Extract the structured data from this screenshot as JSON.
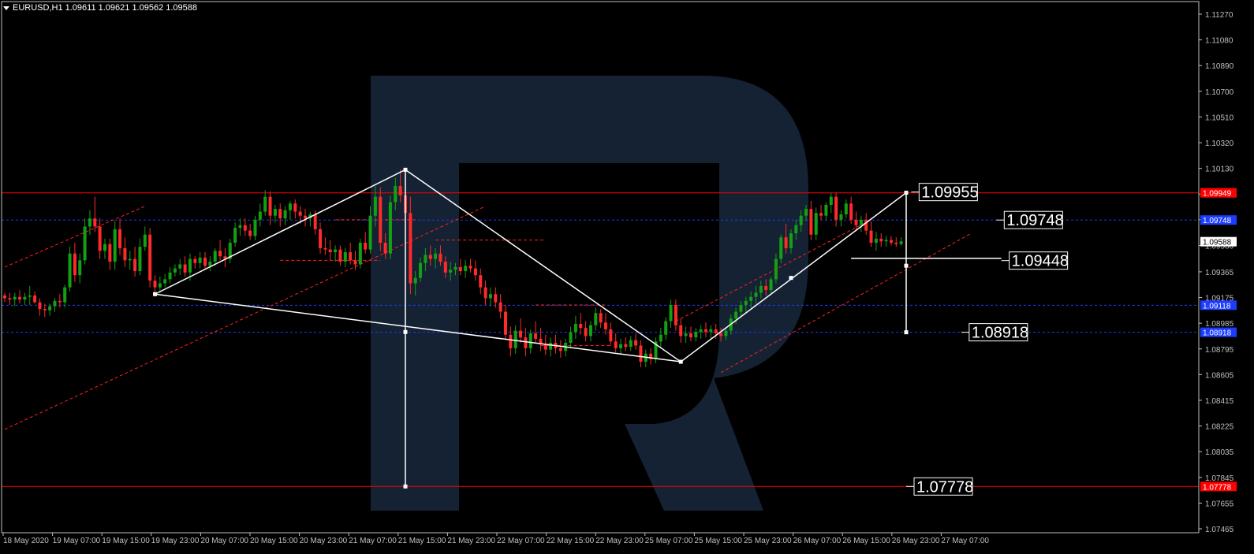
{
  "header": {
    "symbol_line": "EURUSD,H1  1.09611 1.09621 1.09562 1.09588"
  },
  "colors": {
    "background": "#000000",
    "axis": "#c0c0c0",
    "bull": "#13a113",
    "bear": "#ff2a2a",
    "level_red": "#ff0000",
    "level_blue": "#1c3cff",
    "pattern": "#ffffff",
    "channel": "#ff2020",
    "watermark": "#142233"
  },
  "chart_data": {
    "type": "candlestick",
    "symbol": "EURUSD",
    "timeframe": "H1",
    "ohlc_last": {
      "open": 1.09611,
      "high": 1.09621,
      "low": 1.09562,
      "close": 1.09588
    },
    "ylim": [
      1.07465,
      1.1127
    ],
    "y_ticks": [
      "1.11270",
      "1.11080",
      "1.10890",
      "1.10700",
      "1.10510",
      "1.10320",
      "1.10130",
      "1.09940",
      "1.09750",
      "1.09560",
      "1.09365",
      "1.09175",
      "1.08985",
      "1.08795",
      "1.08605",
      "1.08415",
      "1.08225",
      "1.08035",
      "1.07845",
      "1.07655",
      "1.07465"
    ],
    "x_labels": [
      "18 May 2020",
      "19 May 07:00",
      "19 May 15:00",
      "19 May 23:00",
      "20 May 07:00",
      "20 May 15:00",
      "20 May 23:00",
      "21 May 07:00",
      "21 May 15:00",
      "21 May 23:00",
      "22 May 07:00",
      "22 May 15:00",
      "22 May 23:00",
      "25 May 07:00",
      "25 May 15:00",
      "25 May 23:00",
      "26 May 07:00",
      "26 May 15:00",
      "26 May 23:00",
      "27 May 07:00"
    ],
    "axis_markers": [
      {
        "label": "1.09949",
        "value": 1.09949,
        "color": "red"
      },
      {
        "label": "1.09748",
        "value": 1.09748,
        "color": "blue"
      },
      {
        "label": "1.09588",
        "value": 1.09588,
        "color": "current"
      },
      {
        "label": "1.09118",
        "value": 1.09118,
        "color": "blue"
      },
      {
        "label": "1.08918",
        "value": 1.08918,
        "color": "blue"
      },
      {
        "label": "1.07778",
        "value": 1.07778,
        "color": "red"
      }
    ],
    "horizontal_levels": [
      {
        "value": 1.09949,
        "style": "solid",
        "color": "red"
      },
      {
        "value": 1.09748,
        "style": "dashed",
        "color": "blue"
      },
      {
        "value": 1.09118,
        "style": "dashed",
        "color": "blue"
      },
      {
        "value": 1.08918,
        "style": "dashed",
        "color": "blue"
      },
      {
        "value": 1.07778,
        "style": "solid",
        "color": "red"
      }
    ],
    "annotations": [
      {
        "label": "1.09955",
        "bar": 181,
        "value": 1.09955
      },
      {
        "label": "1.09748",
        "bar": 198,
        "value": 1.09748
      },
      {
        "label": "1.09448",
        "bar": 199,
        "value": 1.09448
      },
      {
        "label": "1.08918",
        "bar": 191,
        "value": 1.08918
      },
      {
        "label": "1.07778",
        "bar": 180,
        "value": 1.07778
      }
    ],
    "pattern_lines": [
      {
        "from": [
          30,
          1.092
        ],
        "to": [
          80,
          1.1012
        ]
      },
      {
        "from": [
          80,
          1.1012
        ],
        "to": [
          135,
          1.087
        ]
      },
      {
        "from": [
          30,
          1.092
        ],
        "to": [
          135,
          1.087
        ]
      },
      {
        "from": [
          135,
          1.087
        ],
        "to": [
          180,
          1.0995
        ]
      },
      {
        "from": [
          80,
          1.1012
        ],
        "to": [
          80,
          1.07778
        ]
      },
      {
        "from": [
          180,
          1.0995
        ],
        "to": [
          180,
          1.08918
        ]
      },
      {
        "from": [
          169,
          1.09465
        ],
        "to": [
          199,
          1.09465
        ]
      }
    ],
    "pattern_points": [
      [
        30,
        1.092
      ],
      [
        80,
        1.1012
      ],
      [
        80,
        1.0892
      ],
      [
        80,
        1.07778
      ],
      [
        135,
        1.087
      ],
      [
        157,
        1.0932
      ],
      [
        180,
        1.0995
      ],
      [
        180,
        1.0941
      ],
      [
        180,
        1.08918
      ]
    ],
    "channel_lines": [
      [
        [
          0,
          1.094
        ],
        [
          28,
          1.0985
        ]
      ],
      [
        [
          0,
          1.082
        ],
        [
          96,
          1.0985
        ]
      ],
      [
        [
          55,
          1.0945
        ],
        [
          75,
          1.0945
        ]
      ],
      [
        [
          66,
          1.0975
        ],
        [
          82,
          1.0975
        ]
      ],
      [
        [
          86,
          1.096
        ],
        [
          108,
          1.096
        ]
      ],
      [
        [
          106,
          1.0912
        ],
        [
          120,
          1.0912
        ]
      ],
      [
        [
          107,
          1.0882
        ],
        [
          121,
          1.0882
        ]
      ],
      [
        [
          134,
          1.09
        ],
        [
          173,
          1.0975
        ]
      ],
      [
        [
          143,
          1.0862
        ],
        [
          193,
          1.0965
        ]
      ]
    ],
    "bars": 192,
    "candles": [
      [
        1.0919,
        1.0921,
        1.0914,
        1.0917
      ],
      [
        1.0917,
        1.0921,
        1.0912,
        1.0916
      ],
      [
        1.0916,
        1.0921,
        1.0911,
        1.0918
      ],
      [
        1.0918,
        1.0923,
        1.0913,
        1.0916
      ],
      [
        1.0916,
        1.0921,
        1.0912,
        1.0918
      ],
      [
        1.0918,
        1.0926,
        1.0912,
        1.0919
      ],
      [
        1.0919,
        1.0922,
        1.0913,
        1.0914
      ],
      [
        1.0914,
        1.0917,
        1.0904,
        1.0909
      ],
      [
        1.0909,
        1.0913,
        1.0903,
        1.0908
      ],
      [
        1.0908,
        1.0913,
        1.0904,
        1.0911
      ],
      [
        1.0911,
        1.0917,
        1.0907,
        1.0915
      ],
      [
        1.0915,
        1.092,
        1.091,
        1.0914
      ],
      [
        1.0914,
        1.0927,
        1.091,
        1.0925
      ],
      [
        1.0925,
        1.0955,
        1.0922,
        1.095
      ],
      [
        1.095,
        1.0958,
        1.0929,
        1.0934
      ],
      [
        1.0934,
        1.095,
        1.0928,
        1.0945
      ],
      [
        1.0945,
        1.0976,
        1.0942,
        1.097
      ],
      [
        1.097,
        1.0982,
        1.0964,
        1.0976
      ],
      [
        1.0976,
        1.0992,
        1.0966,
        1.097
      ],
      [
        1.097,
        1.0976,
        1.0946,
        1.0952
      ],
      [
        1.0952,
        1.0961,
        1.0946,
        1.0957
      ],
      [
        1.0957,
        1.0961,
        1.0938,
        1.0944
      ],
      [
        1.0944,
        1.0974,
        1.0938,
        1.0968
      ],
      [
        1.0968,
        1.0976,
        1.0949,
        1.0954
      ],
      [
        1.0954,
        1.0962,
        1.094,
        1.0945
      ],
      [
        1.0945,
        1.0952,
        1.0938,
        1.0946
      ],
      [
        1.0946,
        1.0955,
        1.0933,
        1.0937
      ],
      [
        1.0937,
        1.0961,
        1.0934,
        1.0955
      ],
      [
        1.0955,
        1.097,
        1.0952,
        1.0964
      ],
      [
        1.0964,
        1.0969,
        1.0925,
        1.093
      ],
      [
        1.093,
        1.0934,
        1.092,
        1.0925
      ],
      [
        1.0925,
        1.0933,
        1.0921,
        1.0928
      ],
      [
        1.0928,
        1.0935,
        1.0925,
        1.0931
      ],
      [
        1.0931,
        1.094,
        1.0928,
        1.0936
      ],
      [
        1.0936,
        1.0942,
        1.0933,
        1.0939
      ],
      [
        1.0939,
        1.0946,
        1.0934,
        1.0942
      ],
      [
        1.0942,
        1.0948,
        1.0933,
        1.0936
      ],
      [
        1.0936,
        1.095,
        1.093,
        1.0946
      ],
      [
        1.0946,
        1.0948,
        1.0939,
        1.0943
      ],
      [
        1.0943,
        1.0951,
        1.0939,
        1.0947
      ],
      [
        1.0947,
        1.0951,
        1.0938,
        1.0941
      ],
      [
        1.0941,
        1.0948,
        1.0937,
        1.0944
      ],
      [
        1.0944,
        1.0954,
        1.0941,
        1.0952
      ],
      [
        1.0952,
        1.096,
        1.0945,
        1.0948
      ],
      [
        1.0948,
        1.0954,
        1.094,
        1.0946
      ],
      [
        1.0946,
        1.0961,
        1.0943,
        1.0958
      ],
      [
        1.0958,
        1.0973,
        1.0955,
        1.0969
      ],
      [
        1.0969,
        1.0976,
        1.0963,
        1.0971
      ],
      [
        1.0971,
        1.0976,
        1.0963,
        1.0967
      ],
      [
        1.0967,
        1.0972,
        1.096,
        1.0963
      ],
      [
        1.0963,
        1.0978,
        1.096,
        1.0975
      ],
      [
        1.0975,
        1.0987,
        1.097,
        1.0981
      ],
      [
        1.0981,
        1.0997,
        1.0978,
        1.0992
      ],
      [
        1.0992,
        1.0996,
        1.0971,
        1.0978
      ],
      [
        1.0978,
        1.0986,
        1.0973,
        1.0983
      ],
      [
        1.0983,
        1.0987,
        1.097,
        1.0976
      ],
      [
        1.0976,
        1.0985,
        1.0971,
        1.0982
      ],
      [
        1.0982,
        1.0989,
        1.0975,
        1.0987
      ],
      [
        1.0987,
        1.099,
        1.0976,
        1.0981
      ],
      [
        1.0981,
        1.0985,
        1.0972,
        1.0978
      ],
      [
        1.0978,
        1.0983,
        1.097,
        1.0976
      ],
      [
        1.0976,
        1.0981,
        1.097,
        1.0979
      ],
      [
        1.0979,
        1.0982,
        1.0964,
        1.0968
      ],
      [
        1.0968,
        1.0973,
        1.095,
        1.0954
      ],
      [
        1.0954,
        1.0962,
        1.0949,
        1.0953
      ],
      [
        1.0953,
        1.096,
        1.0945,
        1.0951
      ],
      [
        1.0951,
        1.0956,
        1.0944,
        1.0953
      ],
      [
        1.0953,
        1.0956,
        1.0941,
        1.0944
      ],
      [
        1.0944,
        1.0954,
        1.094,
        1.0951
      ],
      [
        1.0951,
        1.0958,
        1.0942,
        1.0945
      ],
      [
        1.0945,
        1.0952,
        1.0938,
        1.0942
      ],
      [
        1.0942,
        1.0961,
        1.0939,
        1.0958
      ],
      [
        1.0958,
        1.0966,
        1.095,
        1.0953
      ],
      [
        1.0953,
        1.0985,
        1.095,
        1.0978
      ],
      [
        1.0978,
        1.1,
        1.097,
        1.0992
      ],
      [
        1.0992,
        1.0999,
        1.0952,
        1.0958
      ],
      [
        1.0958,
        1.0965,
        1.0946,
        1.095
      ],
      [
        1.095,
        1.0993,
        1.0946,
        1.0988
      ],
      [
        1.0988,
        1.1006,
        1.0982,
        1.1
      ],
      [
        1.1,
        1.1012,
        1.0988,
        1.0993
      ],
      [
        1.0993,
        1.0997,
        1.097,
        1.098
      ],
      [
        1.098,
        1.0992,
        1.092,
        1.0928
      ],
      [
        1.0928,
        1.0937,
        1.0919,
        1.0932
      ],
      [
        1.0932,
        1.0947,
        1.0929,
        1.0943
      ],
      [
        1.0943,
        1.0954,
        1.0937,
        1.0949
      ],
      [
        1.0949,
        1.0956,
        1.0941,
        1.0946
      ],
      [
        1.0946,
        1.0954,
        1.0939,
        1.095
      ],
      [
        1.095,
        1.0956,
        1.0941,
        1.0944
      ],
      [
        1.0944,
        1.0948,
        1.0932,
        1.0936
      ],
      [
        1.0936,
        1.0944,
        1.093,
        1.0938
      ],
      [
        1.0938,
        1.0943,
        1.0934,
        1.094
      ],
      [
        1.094,
        1.0946,
        1.0934,
        1.0937
      ],
      [
        1.0937,
        1.0945,
        1.0932,
        1.0941
      ],
      [
        1.0941,
        1.0946,
        1.0936,
        1.0939
      ],
      [
        1.0939,
        1.0945,
        1.093,
        1.0934
      ],
      [
        1.0934,
        1.0939,
        1.092,
        1.0925
      ],
      [
        1.0925,
        1.093,
        1.0912,
        1.0917
      ],
      [
        1.0917,
        1.0925,
        1.0911,
        1.092
      ],
      [
        1.092,
        1.0925,
        1.091,
        1.0914
      ],
      [
        1.0914,
        1.092,
        1.0902,
        1.0907
      ],
      [
        1.0907,
        1.0912,
        1.0886,
        1.089
      ],
      [
        1.089,
        1.0896,
        1.0874,
        1.088
      ],
      [
        1.088,
        1.0897,
        1.0876,
        1.0893
      ],
      [
        1.0893,
        1.0902,
        1.0884,
        1.0888
      ],
      [
        1.0888,
        1.0895,
        1.0874,
        1.088
      ],
      [
        1.088,
        1.0894,
        1.0876,
        1.0891
      ],
      [
        1.0891,
        1.09,
        1.0884,
        1.0887
      ],
      [
        1.0887,
        1.0895,
        1.0878,
        1.0883
      ],
      [
        1.0883,
        1.089,
        1.0875,
        1.0879
      ],
      [
        1.0879,
        1.0888,
        1.0874,
        1.0884
      ],
      [
        1.0884,
        1.089,
        1.0876,
        1.088
      ],
      [
        1.088,
        1.0886,
        1.0873,
        1.0878
      ],
      [
        1.0878,
        1.0887,
        1.0874,
        1.0884
      ],
      [
        1.0884,
        1.0896,
        1.088,
        1.0892
      ],
      [
        1.0892,
        1.0904,
        1.0887,
        1.0898
      ],
      [
        1.0898,
        1.0906,
        1.089,
        1.0895
      ],
      [
        1.0895,
        1.09,
        1.0885,
        1.0889
      ],
      [
        1.0889,
        1.09,
        1.0885,
        1.0897
      ],
      [
        1.0897,
        1.091,
        1.0893,
        1.0906
      ],
      [
        1.0906,
        1.0909,
        1.0895,
        1.0899
      ],
      [
        1.0899,
        1.0906,
        1.089,
        1.0894
      ],
      [
        1.0894,
        1.0899,
        1.0882,
        1.0885
      ],
      [
        1.0885,
        1.0891,
        1.0877,
        1.088
      ],
      [
        1.088,
        1.0887,
        1.0875,
        1.0883
      ],
      [
        1.0883,
        1.0888,
        1.0878,
        1.0881
      ],
      [
        1.0881,
        1.0889,
        1.0878,
        1.0886
      ],
      [
        1.0886,
        1.0891,
        1.0879,
        1.0882
      ],
      [
        1.0882,
        1.0886,
        1.0866,
        1.087
      ],
      [
        1.087,
        1.0879,
        1.0866,
        1.0876
      ],
      [
        1.0876,
        1.088,
        1.0868,
        1.0872
      ],
      [
        1.0872,
        1.0888,
        1.0869,
        1.0885
      ],
      [
        1.0885,
        1.0895,
        1.088,
        1.089
      ],
      [
        1.089,
        1.0903,
        1.0886,
        1.09
      ],
      [
        1.09,
        1.0916,
        1.0895,
        1.0912
      ],
      [
        1.0912,
        1.0916,
        1.0893,
        1.0897
      ],
      [
        1.0897,
        1.0902,
        1.0884,
        1.0889
      ],
      [
        1.0889,
        1.0896,
        1.0884,
        1.0891
      ],
      [
        1.0891,
        1.0896,
        1.0885,
        1.0888
      ],
      [
        1.0888,
        1.0895,
        1.0885,
        1.0892
      ],
      [
        1.0892,
        1.0897,
        1.0887,
        1.0894
      ],
      [
        1.0894,
        1.0899,
        1.0888,
        1.0892
      ],
      [
        1.0892,
        1.0897,
        1.0887,
        1.0894
      ],
      [
        1.0894,
        1.0898,
        1.0887,
        1.0891
      ],
      [
        1.0891,
        1.0895,
        1.0885,
        1.0889
      ],
      [
        1.0889,
        1.0895,
        1.0886,
        1.0893
      ],
      [
        1.0893,
        1.0905,
        1.089,
        1.0902
      ],
      [
        1.0902,
        1.091,
        1.0898,
        1.0907
      ],
      [
        1.0907,
        1.0915,
        1.0903,
        1.0912
      ],
      [
        1.0912,
        1.0918,
        1.0906,
        1.0915
      ],
      [
        1.0915,
        1.0922,
        1.091,
        1.0918
      ],
      [
        1.0918,
        1.0926,
        1.0913,
        1.0921
      ],
      [
        1.0921,
        1.093,
        1.0917,
        1.0926
      ],
      [
        1.0926,
        1.0931,
        1.0919,
        1.0923
      ],
      [
        1.0923,
        1.0933,
        1.092,
        1.0931
      ],
      [
        1.0931,
        1.095,
        1.0928,
        1.0946
      ],
      [
        1.0946,
        1.0964,
        1.0943,
        1.0962
      ],
      [
        1.0962,
        1.0972,
        1.095,
        1.0954
      ],
      [
        1.0954,
        1.0968,
        1.095,
        1.0965
      ],
      [
        1.0965,
        1.0975,
        1.096,
        1.0971
      ],
      [
        1.0971,
        1.0982,
        1.0966,
        1.0978
      ],
      [
        1.0978,
        1.0986,
        1.0974,
        1.0983
      ],
      [
        1.0983,
        1.0989,
        1.096,
        1.0964
      ],
      [
        1.0964,
        1.0984,
        1.096,
        1.098
      ],
      [
        1.098,
        1.0986,
        1.0975,
        1.0978
      ],
      [
        1.0978,
        1.0988,
        1.0975,
        1.0986
      ],
      [
        1.0986,
        1.0995,
        1.098,
        1.0992
      ],
      [
        1.0992,
        1.0995,
        1.097,
        1.0975
      ],
      [
        1.0975,
        1.0982,
        1.097,
        1.0979
      ],
      [
        1.0979,
        1.099,
        1.0976,
        1.0987
      ],
      [
        1.0987,
        1.0992,
        1.0972,
        1.0975
      ],
      [
        1.0975,
        1.0981,
        1.0968,
        1.0971
      ],
      [
        1.0971,
        1.0978,
        1.0966,
        1.0975
      ],
      [
        1.0975,
        1.098,
        1.0964,
        1.0967
      ],
      [
        1.0967,
        1.0974,
        1.0955,
        1.0958
      ],
      [
        1.0958,
        1.0966,
        1.0952,
        1.0961
      ],
      [
        1.0961,
        1.0965,
        1.0955,
        1.0959
      ],
      [
        1.0959,
        1.0963,
        1.0955,
        1.096
      ],
      [
        1.096,
        1.0963,
        1.0956,
        1.0958
      ],
      [
        1.0958,
        1.0962,
        1.0955,
        1.0957
      ],
      [
        1.0957,
        1.0962,
        1.0956,
        1.0959
      ]
    ]
  }
}
